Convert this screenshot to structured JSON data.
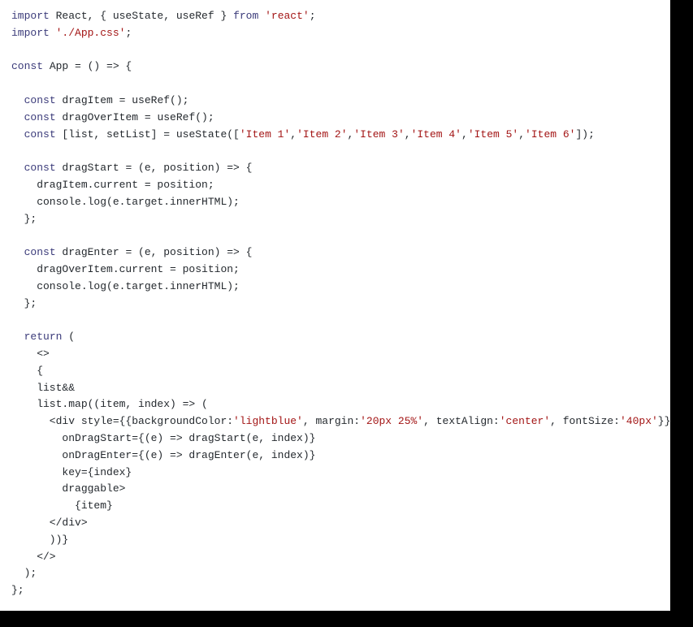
{
  "code": {
    "lines": [
      {
        "tokens": [
          {
            "t": "import",
            "c": "kw"
          },
          {
            "t": " React, { useState, useRef } ",
            "c": ""
          },
          {
            "t": "from",
            "c": "kw"
          },
          {
            "t": " ",
            "c": ""
          },
          {
            "t": "'react'",
            "c": "str"
          },
          {
            "t": ";",
            "c": ""
          }
        ]
      },
      {
        "tokens": [
          {
            "t": "import",
            "c": "kw"
          },
          {
            "t": " ",
            "c": ""
          },
          {
            "t": "'./App.css'",
            "c": "str"
          },
          {
            "t": ";",
            "c": ""
          }
        ]
      },
      {
        "tokens": [
          {
            "t": "",
            "c": ""
          }
        ]
      },
      {
        "tokens": [
          {
            "t": "const",
            "c": "kw"
          },
          {
            "t": " App = () => {",
            "c": ""
          }
        ]
      },
      {
        "tokens": [
          {
            "t": "",
            "c": ""
          }
        ]
      },
      {
        "tokens": [
          {
            "t": "  ",
            "c": ""
          },
          {
            "t": "const",
            "c": "kw"
          },
          {
            "t": " dragItem = useRef();",
            "c": ""
          }
        ]
      },
      {
        "tokens": [
          {
            "t": "  ",
            "c": ""
          },
          {
            "t": "const",
            "c": "kw"
          },
          {
            "t": " dragOverItem = useRef();",
            "c": ""
          }
        ]
      },
      {
        "tokens": [
          {
            "t": "  ",
            "c": ""
          },
          {
            "t": "const",
            "c": "kw"
          },
          {
            "t": " [list, setList] = useState([",
            "c": ""
          },
          {
            "t": "'Item 1'",
            "c": "str"
          },
          {
            "t": ",",
            "c": ""
          },
          {
            "t": "'Item 2'",
            "c": "str"
          },
          {
            "t": ",",
            "c": ""
          },
          {
            "t": "'Item 3'",
            "c": "str"
          },
          {
            "t": ",",
            "c": ""
          },
          {
            "t": "'Item 4'",
            "c": "str"
          },
          {
            "t": ",",
            "c": ""
          },
          {
            "t": "'Item 5'",
            "c": "str"
          },
          {
            "t": ",",
            "c": ""
          },
          {
            "t": "'Item 6'",
            "c": "str"
          },
          {
            "t": "]);",
            "c": ""
          }
        ]
      },
      {
        "tokens": [
          {
            "t": "",
            "c": ""
          }
        ]
      },
      {
        "tokens": [
          {
            "t": "  ",
            "c": ""
          },
          {
            "t": "const",
            "c": "kw"
          },
          {
            "t": " dragStart = (e, position) => {",
            "c": ""
          }
        ]
      },
      {
        "tokens": [
          {
            "t": "    dragItem.current = position;",
            "c": ""
          }
        ]
      },
      {
        "tokens": [
          {
            "t": "    console.log(e.target.innerHTML);",
            "c": ""
          }
        ]
      },
      {
        "tokens": [
          {
            "t": "  };",
            "c": ""
          }
        ]
      },
      {
        "tokens": [
          {
            "t": "",
            "c": ""
          }
        ]
      },
      {
        "tokens": [
          {
            "t": "  ",
            "c": ""
          },
          {
            "t": "const",
            "c": "kw"
          },
          {
            "t": " dragEnter = (e, position) => {",
            "c": ""
          }
        ]
      },
      {
        "tokens": [
          {
            "t": "    dragOverItem.current = position;",
            "c": ""
          }
        ]
      },
      {
        "tokens": [
          {
            "t": "    console.log(e.target.innerHTML);",
            "c": ""
          }
        ]
      },
      {
        "tokens": [
          {
            "t": "  };",
            "c": ""
          }
        ]
      },
      {
        "tokens": [
          {
            "t": "",
            "c": ""
          }
        ]
      },
      {
        "tokens": [
          {
            "t": "  ",
            "c": ""
          },
          {
            "t": "return",
            "c": "kw"
          },
          {
            "t": " (",
            "c": ""
          }
        ]
      },
      {
        "tokens": [
          {
            "t": "    <>",
            "c": ""
          }
        ]
      },
      {
        "tokens": [
          {
            "t": "    {",
            "c": ""
          }
        ]
      },
      {
        "tokens": [
          {
            "t": "    list&&",
            "c": ""
          }
        ]
      },
      {
        "tokens": [
          {
            "t": "    list.map((item, index) => (",
            "c": ""
          }
        ]
      },
      {
        "tokens": [
          {
            "t": "      <div style={{backgroundColor:",
            "c": ""
          },
          {
            "t": "'lightblue'",
            "c": "str"
          },
          {
            "t": ", margin:",
            "c": ""
          },
          {
            "t": "'20px 25%'",
            "c": "str"
          },
          {
            "t": ", textAlign:",
            "c": ""
          },
          {
            "t": "'center'",
            "c": "str"
          },
          {
            "t": ", fontSize:",
            "c": ""
          },
          {
            "t": "'40px'",
            "c": "str"
          },
          {
            "t": "}}",
            "c": ""
          }
        ]
      },
      {
        "tokens": [
          {
            "t": "        onDragStart={(e) => dragStart(e, index)}",
            "c": ""
          }
        ]
      },
      {
        "tokens": [
          {
            "t": "        onDragEnter={(e) => dragEnter(e, index)}",
            "c": ""
          }
        ]
      },
      {
        "tokens": [
          {
            "t": "        key={index}",
            "c": ""
          }
        ]
      },
      {
        "tokens": [
          {
            "t": "        draggable>",
            "c": ""
          }
        ]
      },
      {
        "tokens": [
          {
            "t": "          {item}",
            "c": ""
          }
        ]
      },
      {
        "tokens": [
          {
            "t": "      </div>",
            "c": ""
          }
        ]
      },
      {
        "tokens": [
          {
            "t": "      ))}",
            "c": ""
          }
        ]
      },
      {
        "tokens": [
          {
            "t": "    </>",
            "c": ""
          }
        ]
      },
      {
        "tokens": [
          {
            "t": "  );",
            "c": ""
          }
        ]
      },
      {
        "tokens": [
          {
            "t": "};",
            "c": ""
          }
        ]
      }
    ]
  }
}
